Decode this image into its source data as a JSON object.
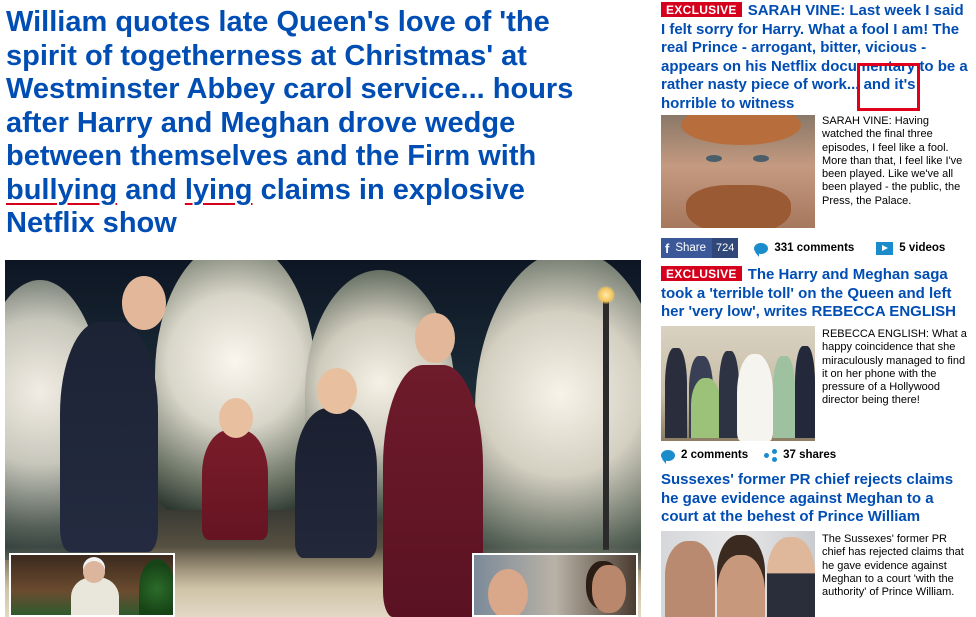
{
  "main": {
    "headline_part1": "William quotes late Queen's love of 'the spirit of togetherness at Christmas' at Westminster Abbey carol service... hours after Harry and Meghan drove wedge between themselves and the Firm with ",
    "headline_bullying": "bullying",
    "headline_and": " and ",
    "headline_lying": "lying",
    "headline_part2": " claims in explosive Netflix show"
  },
  "sidebar": {
    "story1": {
      "badge": "EXCLUSIVE",
      "headline": "SARAH VINE: Last week I said I felt sorry for Harry. What a fool I am! The real Prince - arrogant, bitter, vicious - appears on his Netflix documentary to be a rather nasty piece of work... and it's horrible to witness",
      "snippet": "SARAH VINE: Having watched the final three episodes, I feel like a fool. More than that, I feel like I've been played. Like we've all been played - the public, the Press, the Palace.",
      "share_label": "Share",
      "share_count": "724",
      "comments": "331 comments",
      "videos": "5 videos"
    },
    "story2": {
      "badge": "EXCLUSIVE",
      "headline": "The Harry and Meghan saga took a 'terrible toll' on the Queen and left her 'very low', writes REBECCA ENGLISH",
      "snippet": "REBECCA ENGLISH: What a happy coincidence that she miraculously managed to find it on her phone with the pressure of a Hollywood director being there!",
      "comments": "2 comments",
      "shares": "37 shares"
    },
    "story3": {
      "headline": "Sussexes' former PR chief rejects claims he gave evidence against Meghan to a court at the behest of Prince William",
      "snippet": "The Sussexes' former PR chief has rejected claims that he gave evidence against Meghan to a court 'with the authority' of Prince William."
    }
  },
  "colors": {
    "headline_blue": "#004db3",
    "exclusive_red": "#d6001c",
    "annotation_red": "#e0001b",
    "facebook_blue": "#3b5998",
    "icon_blue": "#1a8ccc"
  }
}
